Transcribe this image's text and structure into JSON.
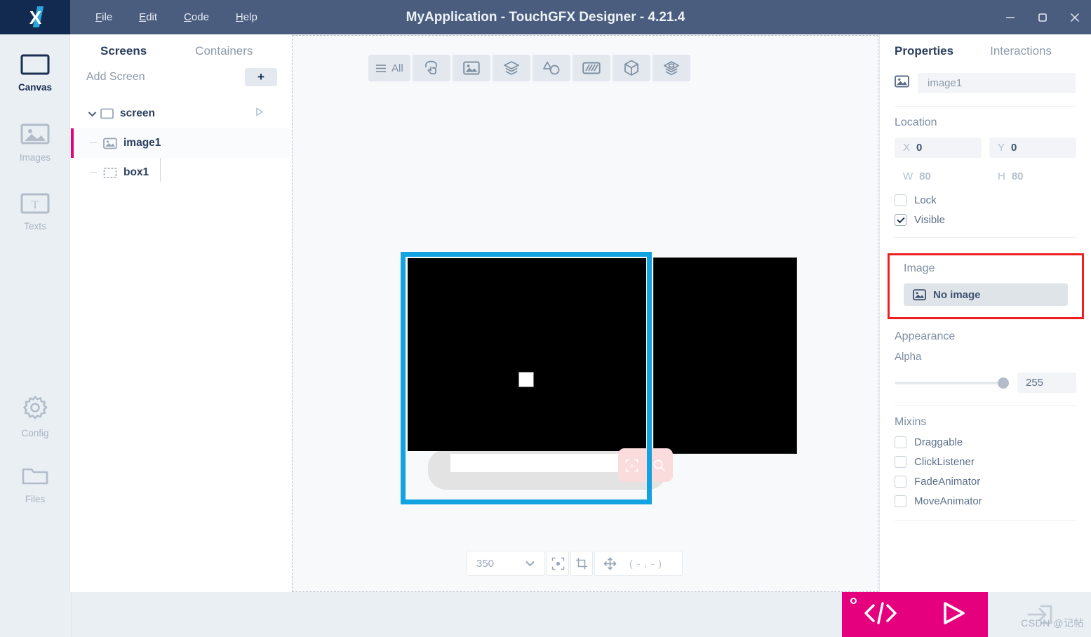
{
  "window": {
    "title": "MyApplication - TouchGFX Designer - 4.21.4",
    "logo": "touchgfx-logo",
    "controls": [
      {
        "name": "minimize-button",
        "icon": "minimize-icon"
      },
      {
        "name": "maximize-button",
        "icon": "maximize-icon"
      },
      {
        "name": "close-button",
        "icon": "close-icon"
      }
    ]
  },
  "menubar": {
    "items": [
      {
        "label": "File",
        "mnemonic": "F",
        "rest": "ile"
      },
      {
        "label": "Edit",
        "mnemonic": "E",
        "rest": "dit"
      },
      {
        "label": "Code",
        "mnemonic": "C",
        "rest": "ode"
      },
      {
        "label": "Help",
        "mnemonic": "H",
        "rest": "elp"
      }
    ]
  },
  "rail": {
    "items": [
      {
        "label": "Canvas",
        "icon": "canvas-rect-icon",
        "active": true
      },
      {
        "label": "Images",
        "icon": "image-picture-icon",
        "active": false
      },
      {
        "label": "Texts",
        "icon": "text-t-icon",
        "active": false
      },
      {
        "label": "Config",
        "icon": "gear-icon",
        "active": false
      },
      {
        "label": "Files",
        "icon": "folder-icon",
        "active": false
      }
    ],
    "menu_toggle": "hamburger-icon"
  },
  "tree_panel": {
    "tabs": [
      {
        "label": "Screens",
        "active": true
      },
      {
        "label": "Containers",
        "active": false
      }
    ],
    "add_screen_label": "Add Screen",
    "add_button_label": "+",
    "nodes": [
      {
        "label": "screen",
        "icon": "screen-rect-icon",
        "level": 0,
        "selected": false,
        "expanded": true,
        "action_icon": "play-triangle-icon"
      },
      {
        "label": "image1",
        "icon": "image-widget-icon",
        "level": 1,
        "selected": true
      },
      {
        "label": "box1",
        "icon": "box-widget-icon",
        "level": 1,
        "selected": false
      }
    ]
  },
  "canvas": {
    "toolbar": [
      {
        "name": "filter-all-button",
        "icon": "list-lines-icon",
        "label": "All"
      },
      {
        "name": "interaction-widgets-button",
        "icon": "touch-hand-icon",
        "label": ""
      },
      {
        "name": "image-widgets-button",
        "icon": "picture-icon",
        "label": ""
      },
      {
        "name": "container-widgets-button",
        "icon": "layers-icon",
        "label": ""
      },
      {
        "name": "shape-widgets-button",
        "icon": "shape-circle-icon",
        "label": ""
      },
      {
        "name": "progress-widgets-button",
        "icon": "progressbar-icon",
        "label": ""
      },
      {
        "name": "3d-widgets-button",
        "icon": "cube-icon",
        "label": ""
      },
      {
        "name": "misc-widgets-button",
        "icon": "stacked-layers-icon",
        "label": ""
      }
    ],
    "bottombar": {
      "zoom_value": "350",
      "zoom_caret": "chevron-down-icon",
      "fit_icon": "fit-to-screen-icon",
      "crop_icon": "crop-icon",
      "move_icon": "move-cross-icon",
      "coordinates": "( - , - )"
    },
    "selection_color": "#12a3e0",
    "widgets": [
      {
        "name": "image1-selected-box",
        "fill": "#000000"
      },
      {
        "name": "box1-background-box",
        "fill": "#000000"
      },
      {
        "name": "white-marker-square",
        "fill": "#ffffff"
      }
    ]
  },
  "properties": {
    "tabs": [
      {
        "label": "Properties",
        "active": true
      },
      {
        "label": "Interactions",
        "active": false
      }
    ],
    "widget_icon": "image-widget-icon",
    "widget_name": "image1",
    "location": {
      "title": "Location",
      "x_key": "X",
      "x_value": "0",
      "y_key": "Y",
      "y_value": "0",
      "w_key": "W",
      "w_value": "80",
      "h_key": "H",
      "h_value": "80"
    },
    "lock": {
      "label": "Lock",
      "checked": false
    },
    "visible": {
      "label": "Visible",
      "checked": true
    },
    "image": {
      "title": "Image",
      "selector_icon": "image-placeholder-icon",
      "selector_label": "No image",
      "highlight_color": "#f02020"
    },
    "appearance": {
      "title": "Appearance",
      "alpha_label": "Alpha",
      "alpha_value": "255"
    },
    "mixins": {
      "title": "Mixins",
      "items": [
        {
          "label": "Draggable",
          "checked": false
        },
        {
          "label": "ClickListener",
          "checked": false
        },
        {
          "label": "FadeAnimator",
          "checked": false
        },
        {
          "label": "MoveAnimator",
          "checked": false
        }
      ]
    }
  },
  "bottom_bar": {
    "generate_code_icon": "code-brackets-icon",
    "run_icon": "play-triangle-icon",
    "export_icon": "export-arrow-icon",
    "accent_color": "#e5007d",
    "watermark": "CSDN @记帖"
  }
}
